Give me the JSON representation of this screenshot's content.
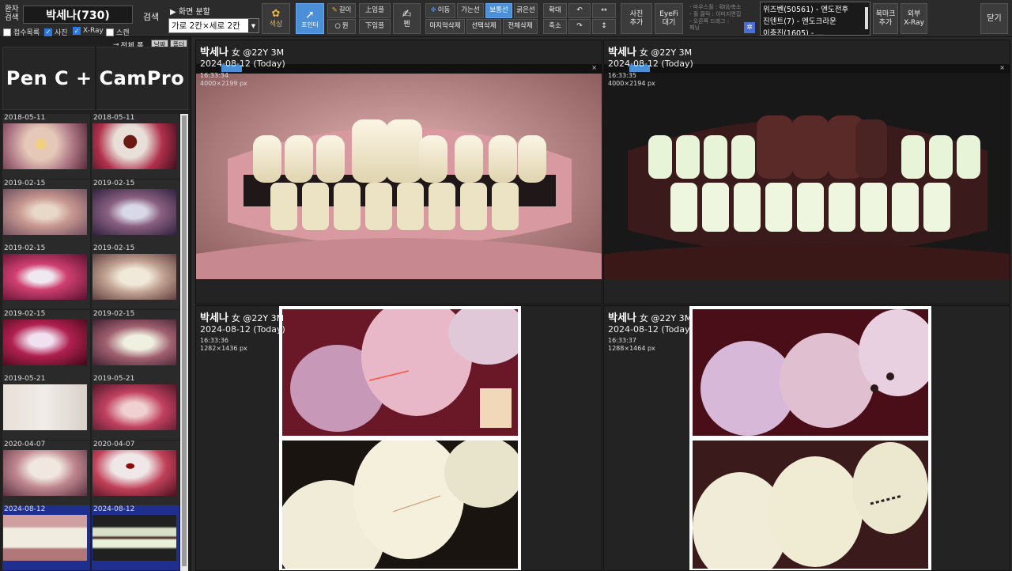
{
  "search": {
    "patient_search_label": "환자\n검색",
    "patient_name": "박세나(730)",
    "search_button": "검색",
    "filter_reception": "접수목록",
    "filter_photo": "사진",
    "filter_xray": "X-Ray",
    "filter_scan": "스캔",
    "screen_split_label": "▶ 화면 분할",
    "screen_split_value": "가로 2칸×세로 2칸"
  },
  "tools": {
    "color": "색상",
    "pointer": "포인터",
    "length": "길이",
    "circle": "원",
    "upper_jaw": "上임플",
    "lower_jaw": "下임플",
    "pen": "펜",
    "move": "이동",
    "thin_line": "가는선",
    "normal_line": "보통선",
    "thick_line": "굵은선",
    "zoom_in": "확대",
    "zoom_out": "축소",
    "delete_last": "마지막삭제",
    "delete_selected": "선택삭제",
    "delete_all": "전체삭제",
    "rotate_left": "↶",
    "rotate_right": "↷",
    "flip_h": "↔",
    "flip_v": "↕",
    "add_photo": "사진\n추가",
    "eyefi": "EyeFi\n대기",
    "help_text": "- 마우스휠 : 확대/축소\n- 휠 클릭 : 이미지편집\n- 오른쪽 드래그 :\n  패닝",
    "bookmarks": [
      "위즈벤(50561) - 엔도전후",
      "진덴트(7) - 엔도크라운",
      "이충진(1605) - ..."
    ],
    "add_bookmark": "북마크\n추가",
    "external_xray": "외부\nX-Ray",
    "close": "닫기"
  },
  "left_panel": {
    "view_all_label": "전체 폴",
    "sort_date": "날짜",
    "sort_folder": "폴더",
    "logo_text": "Pen C + CamPro",
    "thumbnails": [
      {
        "date": "2018-05-11"
      },
      {
        "date": "2018-05-11"
      },
      {
        "date": "2019-02-15"
      },
      {
        "date": "2019-02-15"
      },
      {
        "date": "2019-02-15"
      },
      {
        "date": "2019-02-15"
      },
      {
        "date": "2019-02-15"
      },
      {
        "date": "2019-02-15"
      },
      {
        "date": "2019-05-21"
      },
      {
        "date": "2019-05-21"
      },
      {
        "date": "2020-04-07"
      },
      {
        "date": "2020-04-07"
      },
      {
        "date": "2024-08-12"
      },
      {
        "date": "2024-08-12"
      }
    ]
  },
  "panes": [
    {
      "name": "박세나",
      "sub": "女 @22Y 3M",
      "date": "2024-08-12 (Today)",
      "time": "16:33:34",
      "size": "4000×2199 px"
    },
    {
      "name": "박세나",
      "sub": "女 @22Y 3M",
      "date": "2024-08-12 (Today)",
      "time": "16:33:35",
      "size": "4000×2194 px"
    },
    {
      "name": "박세나",
      "sub": "女 @22Y 3M",
      "date": "2024-08-12 (Today)",
      "time": "16:33:36",
      "size": "1282×1436 px"
    },
    {
      "name": "박세나",
      "sub": "女 @22Y 3M",
      "date": "2024-08-12 (Today)",
      "time": "16:33:37",
      "size": "1288×1464 px"
    }
  ],
  "colors": {
    "accent_blue": "#4a8fd8",
    "selected_thumb": "#1e2f8f"
  }
}
